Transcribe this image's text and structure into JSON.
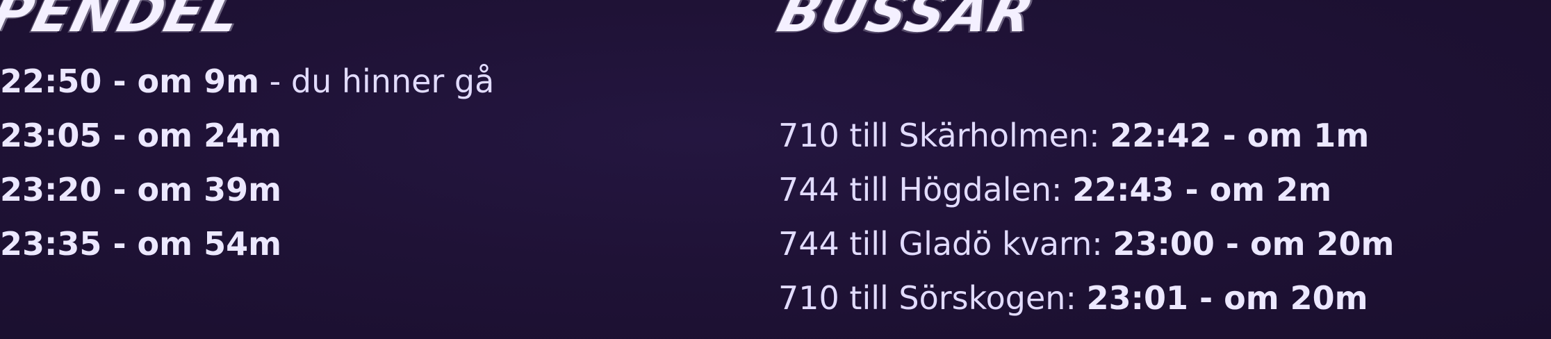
{
  "pendel": {
    "heading": "PENDEL",
    "departures": [
      {
        "time": "22:50 - om 9m",
        "note": " - du hinner gå"
      },
      {
        "time": "23:05 - om 24m",
        "note": ""
      },
      {
        "time": "23:20 - om 39m",
        "note": ""
      },
      {
        "time": "23:35 - om 54m",
        "note": ""
      }
    ]
  },
  "bussar": {
    "heading": "BUSSAR",
    "departures": [
      {
        "route": "710 till Skärholmen: ",
        "time": "22:42 - om 1m"
      },
      {
        "route": "744 till Högdalen: ",
        "time": "22:43 - om 2m"
      },
      {
        "route": "744 till Gladö kvarn: ",
        "time": "23:00 - om 20m"
      },
      {
        "route": "710 till Sörskogen: ",
        "time": "23:01 - om 20m"
      }
    ]
  }
}
